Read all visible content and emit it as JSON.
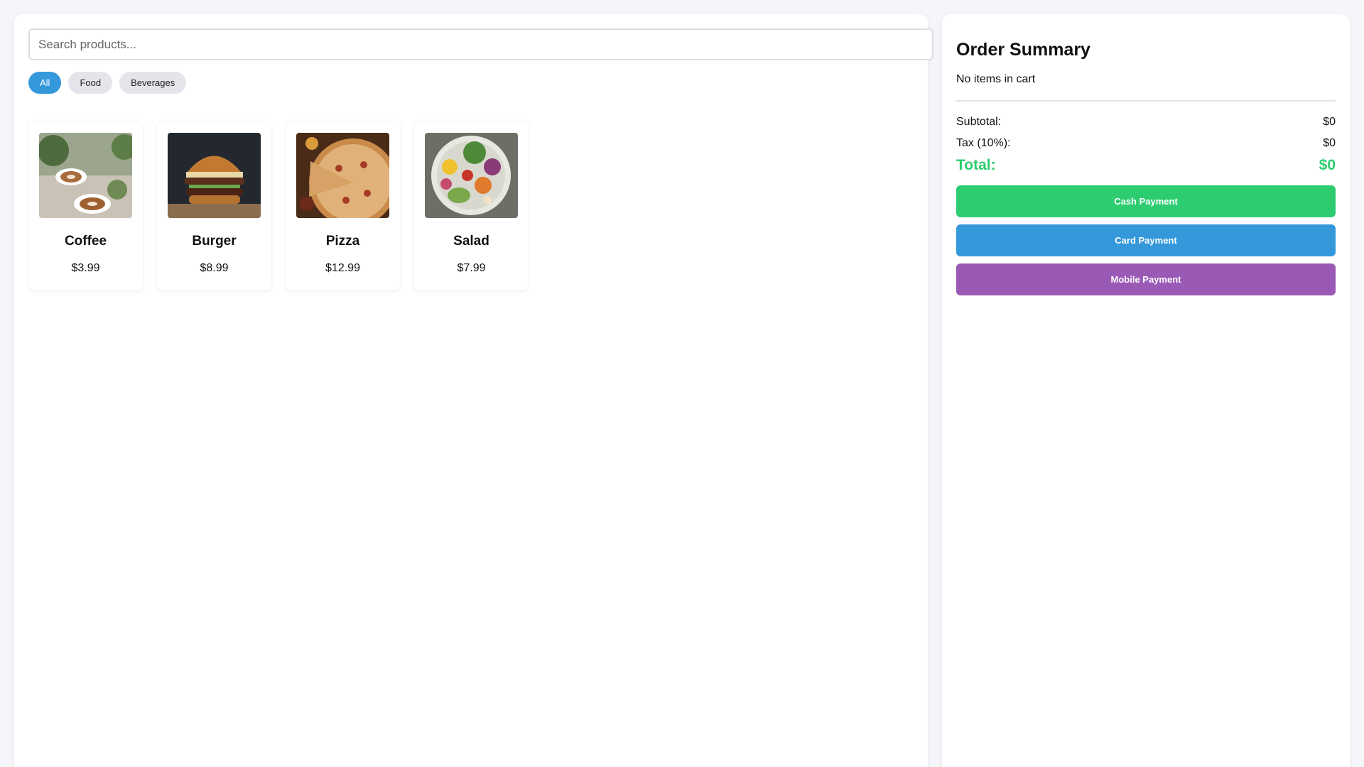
{
  "search": {
    "placeholder": "Search products..."
  },
  "categories": [
    {
      "label": "All",
      "active": true
    },
    {
      "label": "Food",
      "active": false
    },
    {
      "label": "Beverages",
      "active": false
    }
  ],
  "products": [
    {
      "name": "Coffee",
      "price": "$3.99",
      "image": "coffee-image"
    },
    {
      "name": "Burger",
      "price": "$8.99",
      "image": "burger-image"
    },
    {
      "name": "Pizza",
      "price": "$12.99",
      "image": "pizza-image"
    },
    {
      "name": "Salad",
      "price": "$7.99",
      "image": "salad-image"
    }
  ],
  "summary": {
    "title": "Order Summary",
    "empty_message": "No items in cart",
    "subtotal_label": "Subtotal:",
    "subtotal_value": "$0",
    "tax_label": "Tax (10%):",
    "tax_value": "$0",
    "total_label": "Total:",
    "total_value": "$0"
  },
  "payments": {
    "cash_label": "Cash Payment",
    "card_label": "Card Payment",
    "mobile_label": "Mobile Payment"
  },
  "colors": {
    "accent": "#3498db",
    "cash": "#2ecc71",
    "mobile": "#9b59b6",
    "total": "#2ecc71"
  }
}
